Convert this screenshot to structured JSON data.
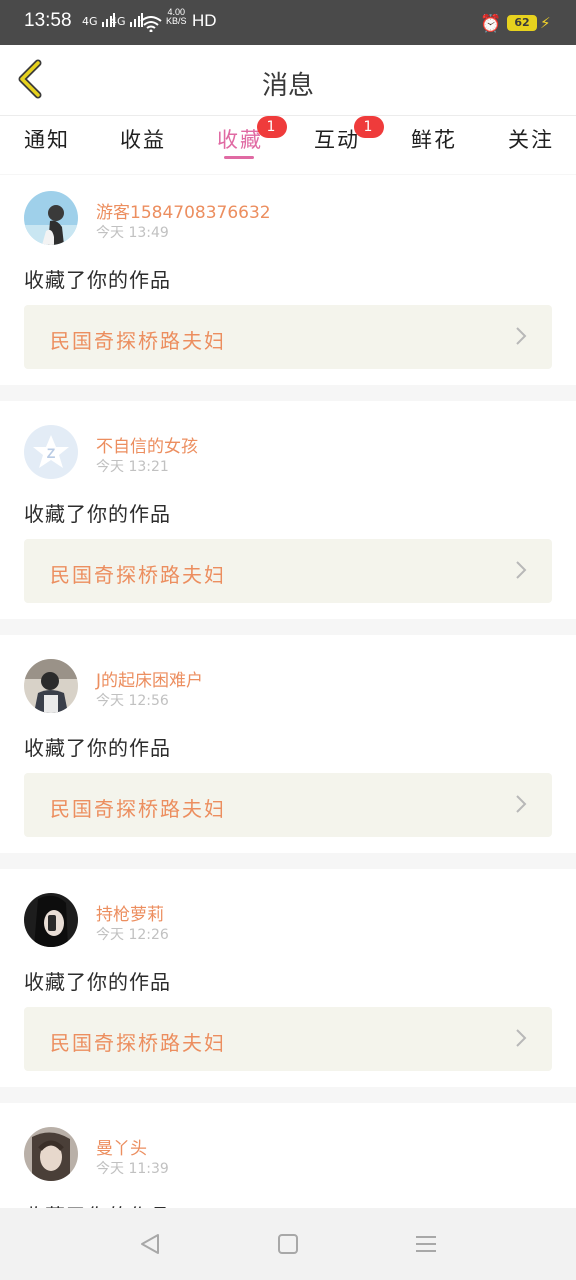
{
  "status_bar": {
    "time": "13:58",
    "signal1": "4G",
    "signal2": "4G",
    "net_speed_value": "4.00",
    "net_speed_unit": "KB/S",
    "hd_label": "HD",
    "battery": "62"
  },
  "header": {
    "title": "消息",
    "back_icon": "chevron-left-icon",
    "accent_color": "#e7d21e"
  },
  "tabs": [
    {
      "label": "通知"
    },
    {
      "label": "收益"
    },
    {
      "label": "收藏",
      "badge": "1",
      "active": true
    },
    {
      "label": "互动",
      "badge": "1"
    },
    {
      "label": "鲜花"
    },
    {
      "label": "关注"
    }
  ],
  "active_color": "#e06aa3",
  "items": [
    {
      "user": "游客1584708376632",
      "time": "今天 13:49",
      "action": "收藏了你的作品",
      "work": "民国奇探桥路夫妇"
    },
    {
      "user": "不自信的女孩",
      "time": "今天 13:21",
      "action": "收藏了你的作品",
      "work": "民国奇探桥路夫妇"
    },
    {
      "user": "J的起床困难户",
      "time": "今天 12:56",
      "action": "收藏了你的作品",
      "work": "民国奇探桥路夫妇"
    },
    {
      "user": "持枪萝莉",
      "time": "今天 12:26",
      "action": "收藏了你的作品",
      "work": "民国奇探桥路夫妇"
    },
    {
      "user": "曼丫头",
      "time": "今天 11:39",
      "action": "收藏了你的作品"
    }
  ],
  "nav": {
    "back": "triangle-back-icon",
    "home": "square-home-icon",
    "menu": "menu-lines-icon"
  }
}
